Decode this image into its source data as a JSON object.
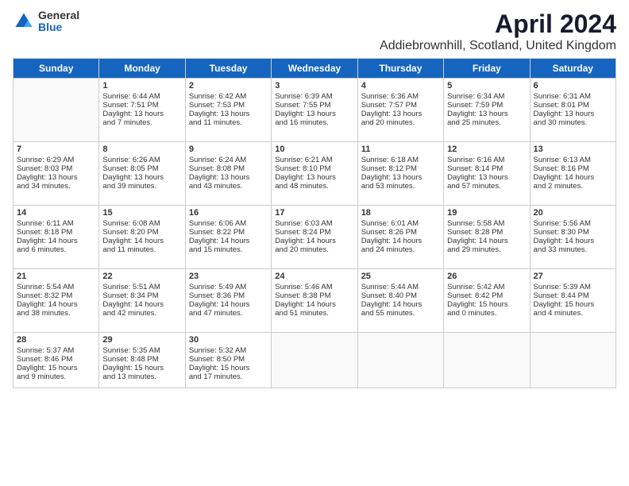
{
  "logo": {
    "general": "General",
    "blue": "Blue"
  },
  "title": "April 2024",
  "subtitle": "Addiebrownhill, Scotland, United Kingdom",
  "headers": [
    "Sunday",
    "Monday",
    "Tuesday",
    "Wednesday",
    "Thursday",
    "Friday",
    "Saturday"
  ],
  "weeks": [
    [
      {
        "day": "",
        "content": ""
      },
      {
        "day": "1",
        "content": "Sunrise: 6:44 AM\nSunset: 7:51 PM\nDaylight: 13 hours\nand 7 minutes."
      },
      {
        "day": "2",
        "content": "Sunrise: 6:42 AM\nSunset: 7:53 PM\nDaylight: 13 hours\nand 11 minutes."
      },
      {
        "day": "3",
        "content": "Sunrise: 6:39 AM\nSunset: 7:55 PM\nDaylight: 13 hours\nand 16 minutes."
      },
      {
        "day": "4",
        "content": "Sunrise: 6:36 AM\nSunset: 7:57 PM\nDaylight: 13 hours\nand 20 minutes."
      },
      {
        "day": "5",
        "content": "Sunrise: 6:34 AM\nSunset: 7:59 PM\nDaylight: 13 hours\nand 25 minutes."
      },
      {
        "day": "6",
        "content": "Sunrise: 6:31 AM\nSunset: 8:01 PM\nDaylight: 13 hours\nand 30 minutes."
      }
    ],
    [
      {
        "day": "7",
        "content": "Sunrise: 6:29 AM\nSunset: 8:03 PM\nDaylight: 13 hours\nand 34 minutes."
      },
      {
        "day": "8",
        "content": "Sunrise: 6:26 AM\nSunset: 8:05 PM\nDaylight: 13 hours\nand 39 minutes."
      },
      {
        "day": "9",
        "content": "Sunrise: 6:24 AM\nSunset: 8:08 PM\nDaylight: 13 hours\nand 43 minutes."
      },
      {
        "day": "10",
        "content": "Sunrise: 6:21 AM\nSunset: 8:10 PM\nDaylight: 13 hours\nand 48 minutes."
      },
      {
        "day": "11",
        "content": "Sunrise: 6:18 AM\nSunset: 8:12 PM\nDaylight: 13 hours\nand 53 minutes."
      },
      {
        "day": "12",
        "content": "Sunrise: 6:16 AM\nSunset: 8:14 PM\nDaylight: 13 hours\nand 57 minutes."
      },
      {
        "day": "13",
        "content": "Sunrise: 6:13 AM\nSunset: 8:16 PM\nDaylight: 14 hours\nand 2 minutes."
      }
    ],
    [
      {
        "day": "14",
        "content": "Sunrise: 6:11 AM\nSunset: 8:18 PM\nDaylight: 14 hours\nand 6 minutes."
      },
      {
        "day": "15",
        "content": "Sunrise: 6:08 AM\nSunset: 8:20 PM\nDaylight: 14 hours\nand 11 minutes."
      },
      {
        "day": "16",
        "content": "Sunrise: 6:06 AM\nSunset: 8:22 PM\nDaylight: 14 hours\nand 15 minutes."
      },
      {
        "day": "17",
        "content": "Sunrise: 6:03 AM\nSunset: 8:24 PM\nDaylight: 14 hours\nand 20 minutes."
      },
      {
        "day": "18",
        "content": "Sunrise: 6:01 AM\nSunset: 8:26 PM\nDaylight: 14 hours\nand 24 minutes."
      },
      {
        "day": "19",
        "content": "Sunrise: 5:58 AM\nSunset: 8:28 PM\nDaylight: 14 hours\nand 29 minutes."
      },
      {
        "day": "20",
        "content": "Sunrise: 5:56 AM\nSunset: 8:30 PM\nDaylight: 14 hours\nand 33 minutes."
      }
    ],
    [
      {
        "day": "21",
        "content": "Sunrise: 5:54 AM\nSunset: 8:32 PM\nDaylight: 14 hours\nand 38 minutes."
      },
      {
        "day": "22",
        "content": "Sunrise: 5:51 AM\nSunset: 8:34 PM\nDaylight: 14 hours\nand 42 minutes."
      },
      {
        "day": "23",
        "content": "Sunrise: 5:49 AM\nSunset: 8:36 PM\nDaylight: 14 hours\nand 47 minutes."
      },
      {
        "day": "24",
        "content": "Sunrise: 5:46 AM\nSunset: 8:38 PM\nDaylight: 14 hours\nand 51 minutes."
      },
      {
        "day": "25",
        "content": "Sunrise: 5:44 AM\nSunset: 8:40 PM\nDaylight: 14 hours\nand 55 minutes."
      },
      {
        "day": "26",
        "content": "Sunrise: 5:42 AM\nSunset: 8:42 PM\nDaylight: 15 hours\nand 0 minutes."
      },
      {
        "day": "27",
        "content": "Sunrise: 5:39 AM\nSunset: 8:44 PM\nDaylight: 15 hours\nand 4 minutes."
      }
    ],
    [
      {
        "day": "28",
        "content": "Sunrise: 5:37 AM\nSunset: 8:46 PM\nDaylight: 15 hours\nand 9 minutes."
      },
      {
        "day": "29",
        "content": "Sunrise: 5:35 AM\nSunset: 8:48 PM\nDaylight: 15 hours\nand 13 minutes."
      },
      {
        "day": "30",
        "content": "Sunrise: 5:32 AM\nSunset: 8:50 PM\nDaylight: 15 hours\nand 17 minutes."
      },
      {
        "day": "",
        "content": ""
      },
      {
        "day": "",
        "content": ""
      },
      {
        "day": "",
        "content": ""
      },
      {
        "day": "",
        "content": ""
      }
    ]
  ]
}
